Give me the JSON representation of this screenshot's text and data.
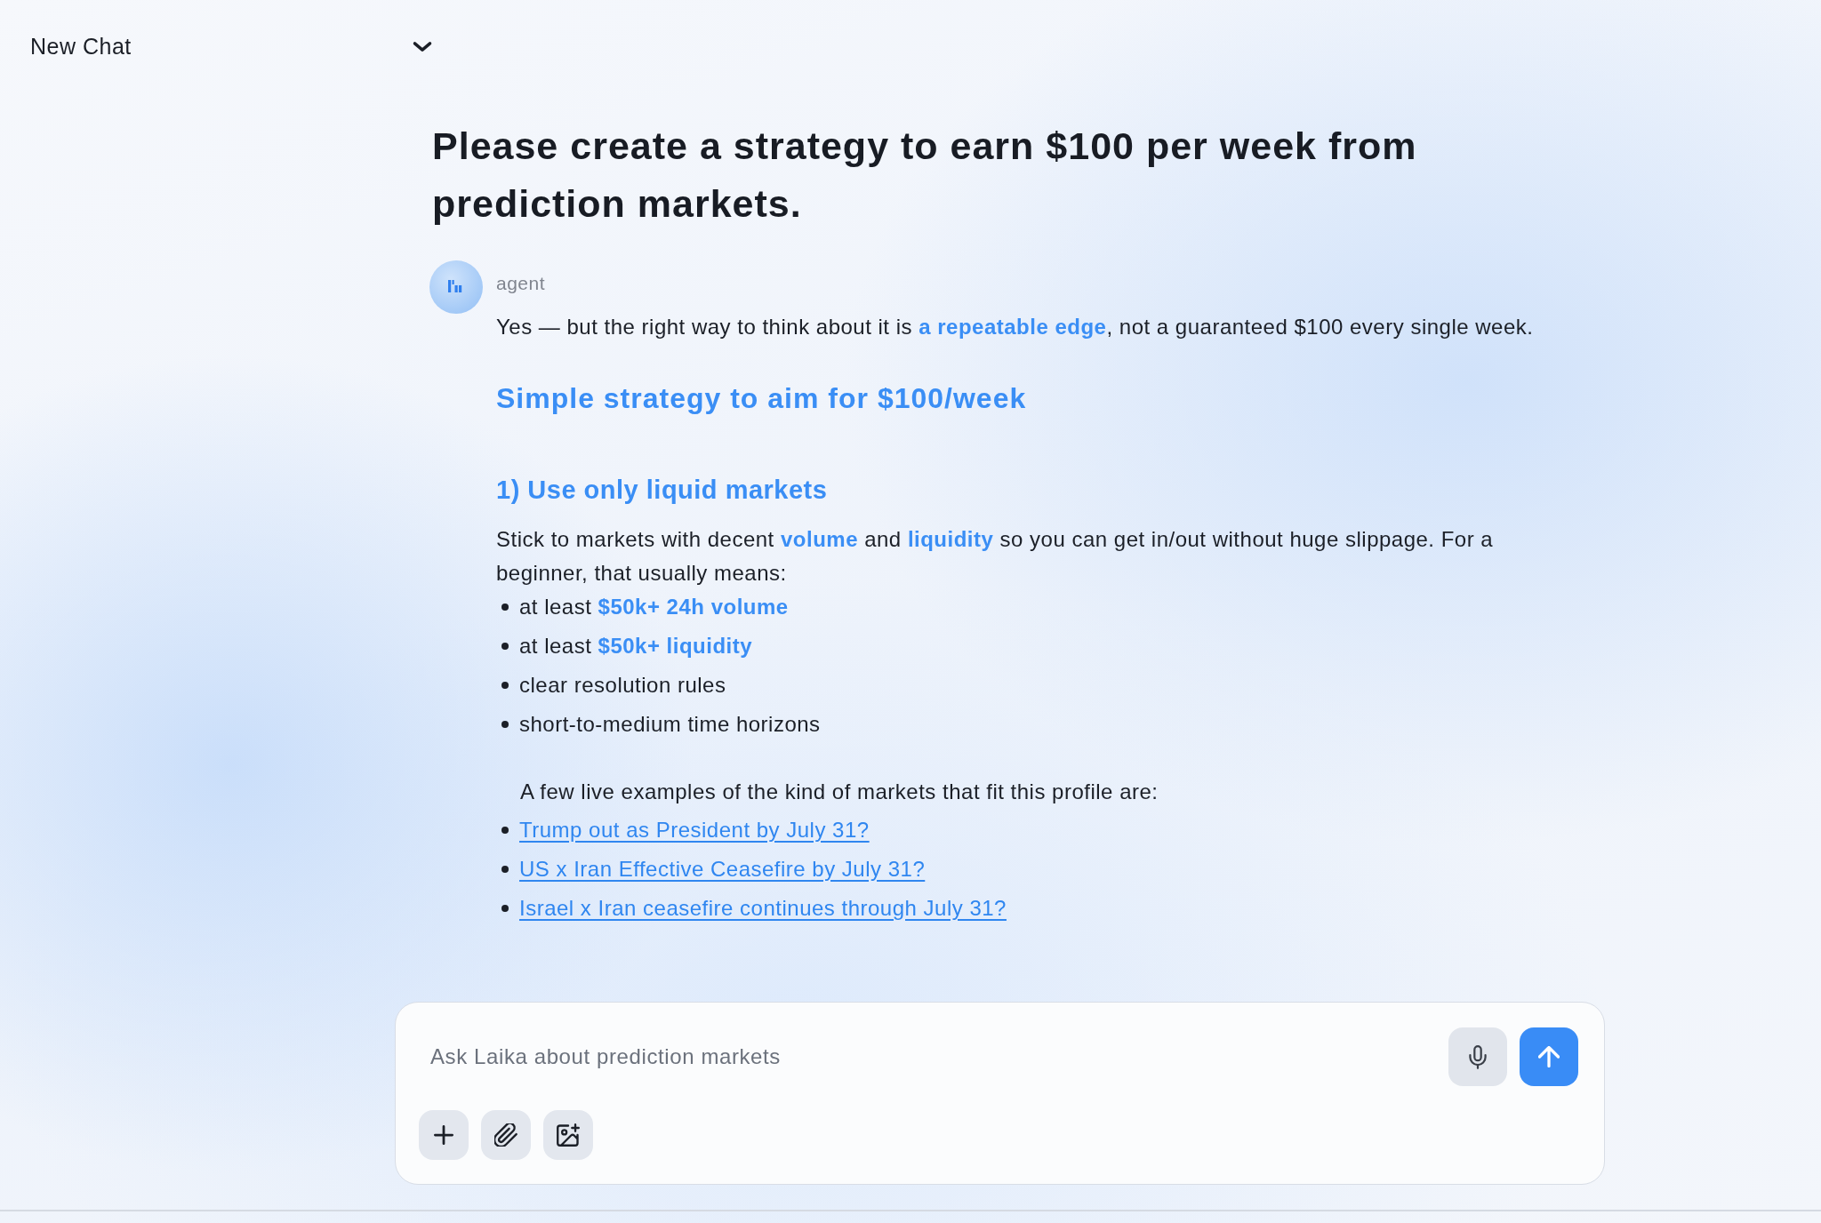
{
  "header": {
    "title": "New Chat"
  },
  "conversation": {
    "question": "Please create a strategy to earn $100 per week from prediction markets.",
    "reply": {
      "author": "agent",
      "blocks": [
        {
          "kind": "paragraph",
          "text": "Yes — but the right way to think about it is **a repeatable edge**, not a guaranteed $100 every single week."
        },
        {
          "kind": "heading",
          "text": "Simple strategy to aim for $100/week"
        },
        {
          "kind": "subheading",
          "text": "1) Use only liquid markets"
        },
        {
          "kind": "paragraph",
          "text": "Stick to markets with decent **volume** and **liquidity** so you can get in/out without huge slippage. For a beginner, that usually means:"
        },
        {
          "kind": "bullets",
          "items": [
            "at least **$50k+ 24h volume**",
            "at least **$50k+ liquidity**",
            "clear resolution rules",
            "short-to-medium time horizons"
          ]
        },
        {
          "kind": "note",
          "text": "A few live examples of the kind of markets that fit this profile are:"
        },
        {
          "kind": "links",
          "items": [
            "Trump out as President by July 31?",
            "US x Iran Effective Ceasefire by July 31?",
            "Israel x Iran ceasefire continues through July 31?"
          ]
        }
      ]
    }
  },
  "composer": {
    "placeholder": "Ask Laika about prediction markets"
  }
}
